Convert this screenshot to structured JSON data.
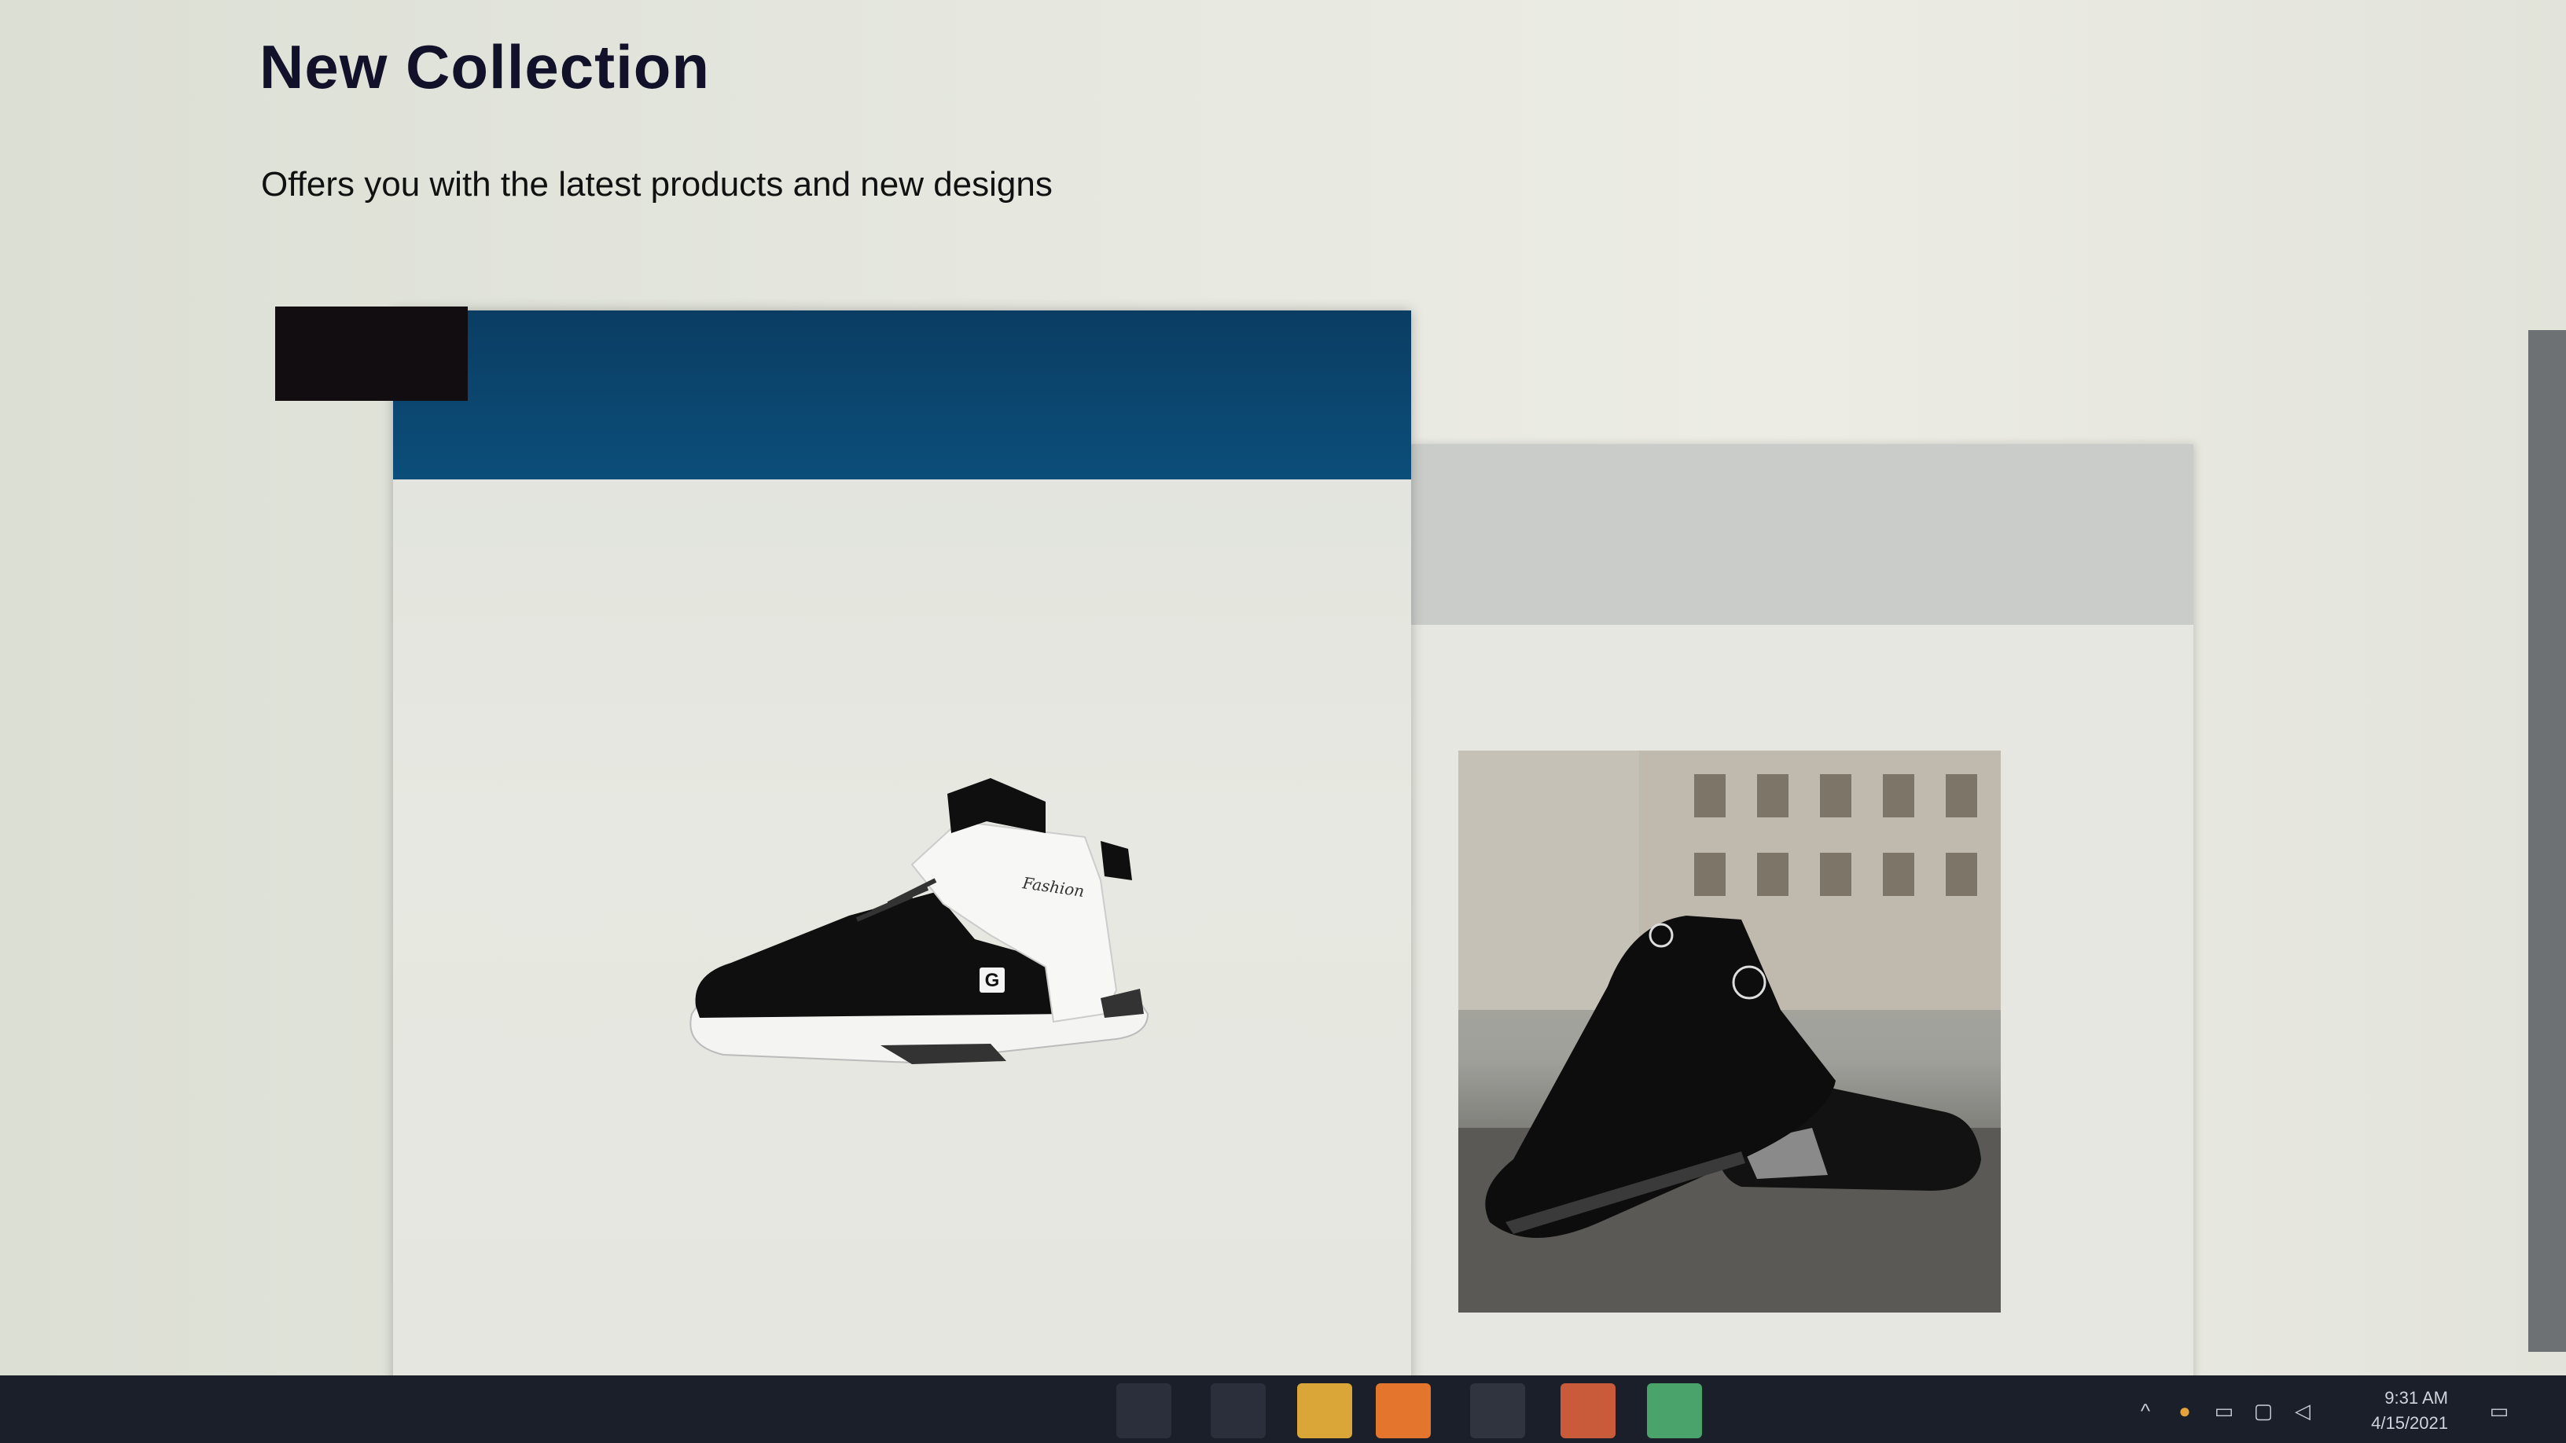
{
  "header": {
    "title": "New Collection",
    "subtitle": "Offers you with the latest products and new designs"
  },
  "products": [
    {
      "name": "high-top-sneaker",
      "shoe_logo": "G",
      "shoe_script": "Fashion"
    },
    {
      "name": "black-athletic-shoes-photo"
    }
  ],
  "taskbar": {
    "apps": [
      "search-icon",
      "task-view-icon",
      "file-explorer-icon",
      "edge-icon",
      "terminal-icon",
      "mail-icon",
      "paint-icon"
    ],
    "tray": {
      "time": "9:31 AM",
      "date": "4/15/2021"
    }
  },
  "colors": {
    "main_card_header": "#0b4e7a",
    "main_card_footer": "#1aa0b8",
    "tag_block": "#120d10"
  }
}
